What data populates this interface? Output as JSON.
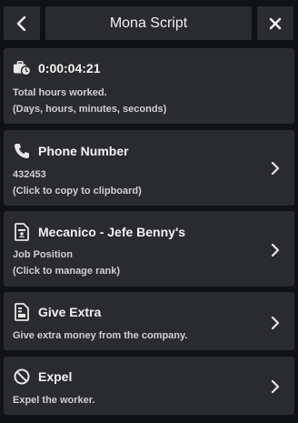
{
  "header": {
    "title": "Mona Script",
    "back_icon": "chevron-left-icon",
    "close_icon": "close-icon"
  },
  "cards": [
    {
      "icon": "briefcase-clock-icon",
      "title": "0:00:04:21",
      "line1": "Total hours worked.",
      "line2": "(Days, hours, minutes, seconds)"
    },
    {
      "icon": "phone-icon",
      "title": "Phone Number",
      "line1": "432453",
      "line2": "(Click to copy to clipboard)"
    },
    {
      "icon": "badge-icon",
      "title": "Mecanico - Jefe Benny's",
      "line1": "Job Position",
      "line2": "(Click to manage rank)"
    },
    {
      "icon": "money-document-icon",
      "title": "Give Extra",
      "line1": "Give extra money from the company."
    },
    {
      "icon": "ban-icon",
      "title": "Expel",
      "line1": "Expel the worker."
    }
  ],
  "colors": {
    "background": "#111214",
    "panel": "#2a2b2e",
    "text": "#f2f2f2",
    "subtext": "#cfcfcf"
  }
}
